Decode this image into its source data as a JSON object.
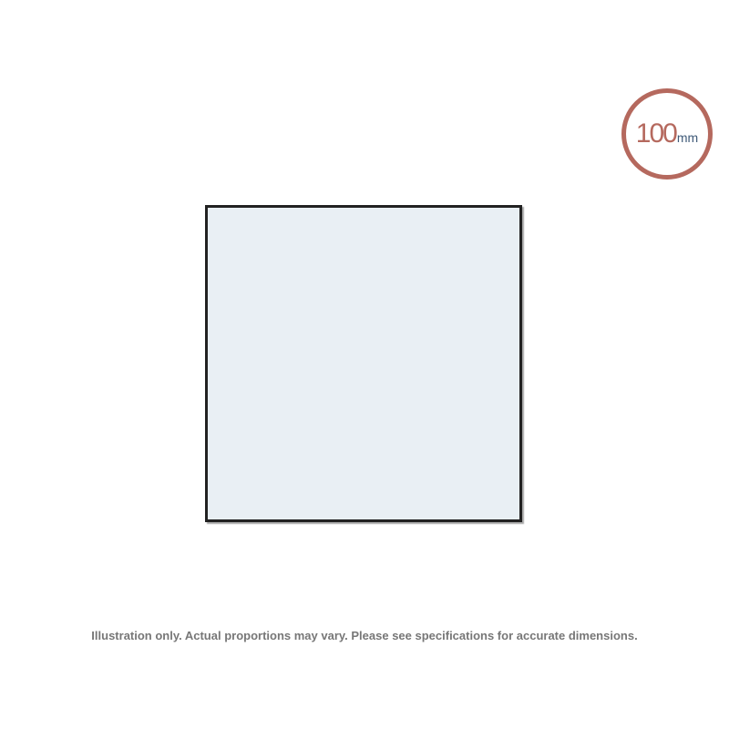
{
  "badge": {
    "value": "100",
    "unit": "mm",
    "ring_color": "#b5695e",
    "value_color": "#b5695e",
    "unit_color": "#3f5a78"
  },
  "product": {
    "fill_color": "#e9eff4",
    "border_color": "#222222"
  },
  "disclaimer": {
    "text": "Illustration only. Actual proportions may vary. Please see specifications for accurate dimensions."
  }
}
